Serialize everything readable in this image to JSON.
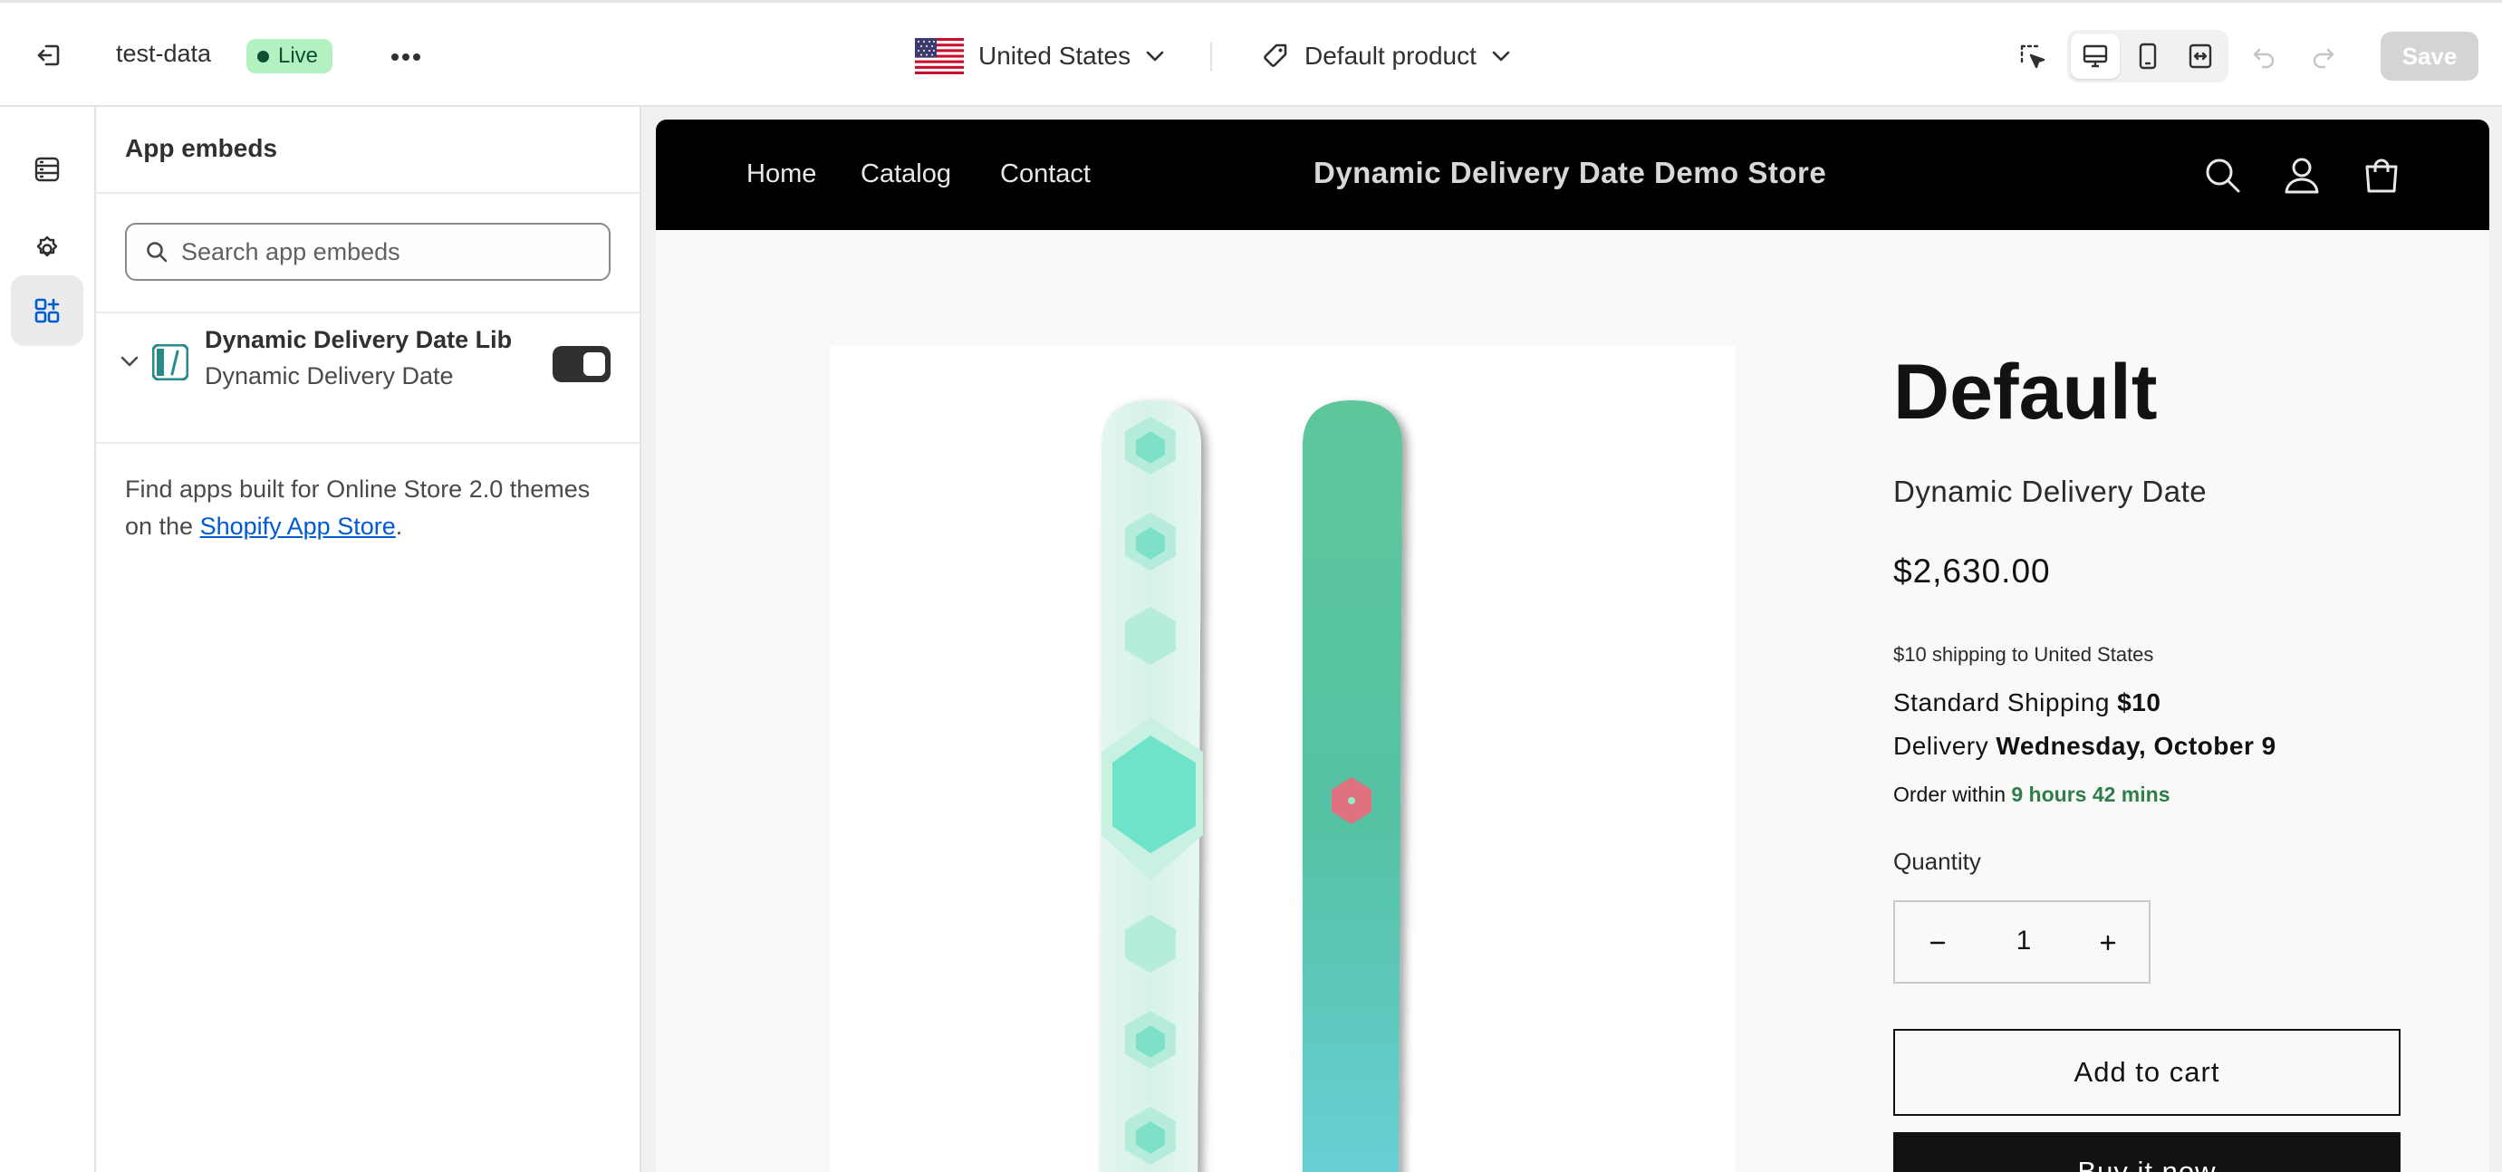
{
  "topbar": {
    "theme_name": "test-data",
    "status_badge": "Live",
    "country": "United States",
    "product": "Default product",
    "save_label": "Save"
  },
  "rail": {
    "items": [
      "sections-icon",
      "settings-icon",
      "app-embeds-icon"
    ],
    "active": "app-embeds-icon"
  },
  "panel": {
    "title": "App embeds",
    "search_placeholder": "Search app embeds",
    "search_value": "",
    "embed": {
      "name": "Dynamic Delivery Date Lib",
      "app": "Dynamic Delivery Date",
      "enabled": true
    },
    "find_apps_text": "Find apps built for Online Store 2.0 themes on the ",
    "find_apps_link": "Shopify App Store",
    "find_apps_end": "."
  },
  "store": {
    "nav": [
      "Home",
      "Catalog",
      "Contact"
    ],
    "name": "Dynamic Delivery Date Demo Store",
    "header_icons": [
      "search-icon",
      "account-icon",
      "cart-icon"
    ]
  },
  "product": {
    "title": "Default",
    "vendor": "Dynamic Delivery Date",
    "price": "$2,630.00",
    "shipping_note": "$10 shipping to United States",
    "standard_label": "Standard Shipping ",
    "standard_value": "$10",
    "delivery_label": "Delivery ",
    "delivery_value": "Wednesday, October 9",
    "order_label": "Order within ",
    "order_value": "9 hours 42 mins",
    "quantity_label": "Quantity",
    "quantity": "1",
    "add_to_cart": "Add to cart",
    "buy_now": "Buy it now"
  },
  "colors": {
    "live_badge_bg": "#b4f1c0",
    "live_badge_text": "#0c5132",
    "link": "#005bd3",
    "countdown_green": "#2f7d4a",
    "store_header": "#000000"
  }
}
